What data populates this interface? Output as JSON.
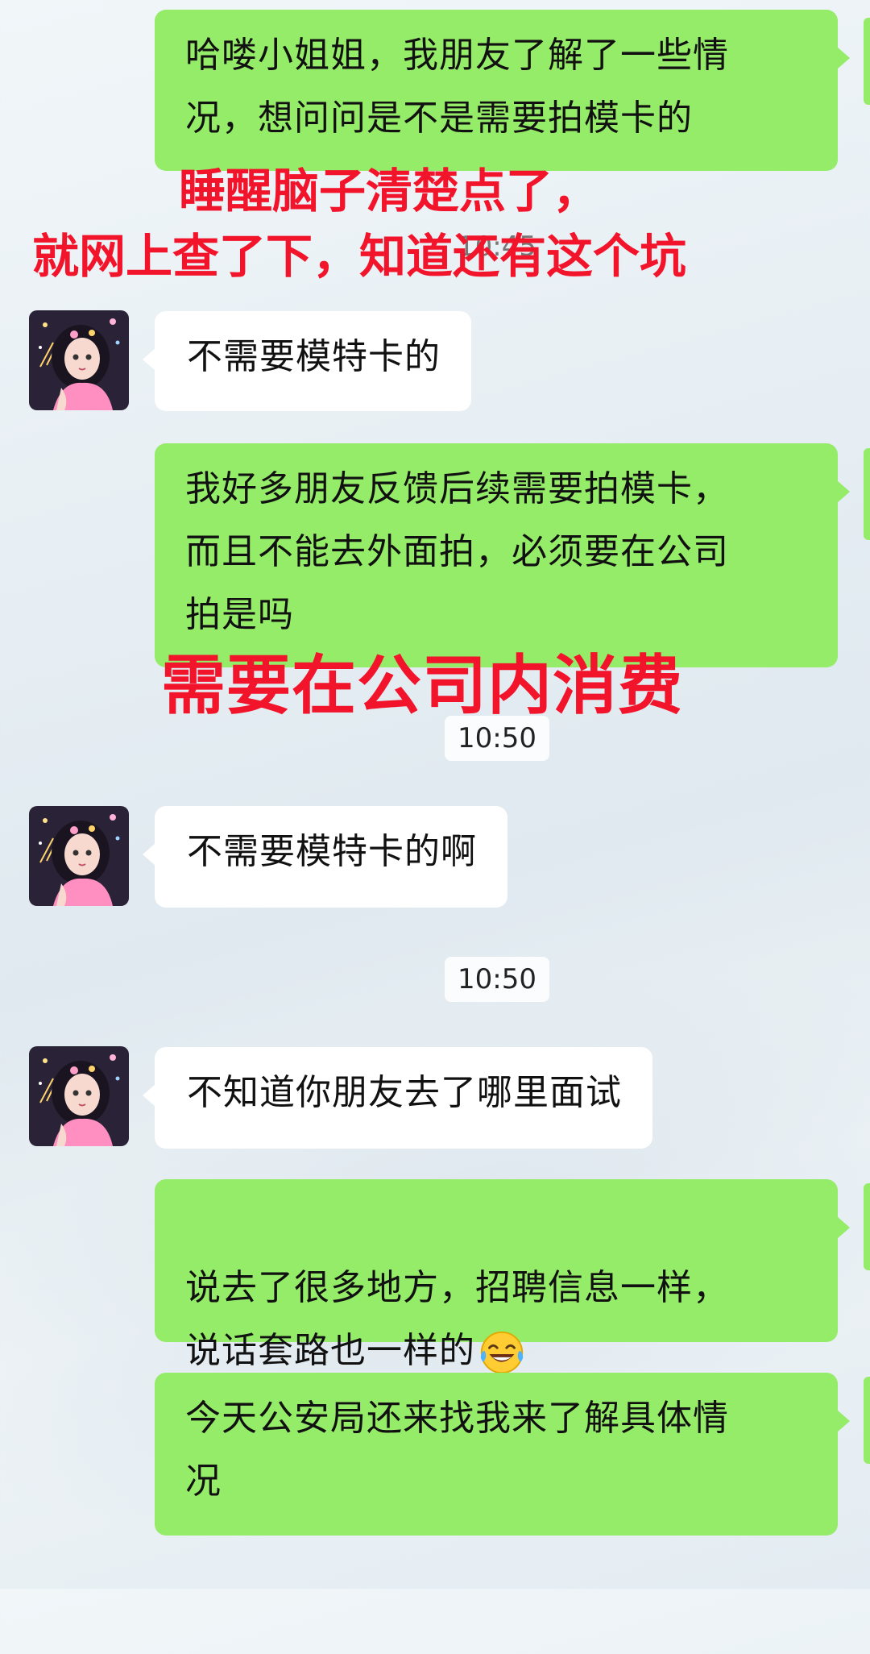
{
  "messages": [
    {
      "text": "哈喽小姐姐，我朋友了解了一些情\n况，想问问是不是需要拍模卡的"
    },
    {
      "text": "不需要模特卡的"
    },
    {
      "text": "我好多朋友反馈后续需要拍模卡，\n而且不能去外面拍，必须要在公司\n拍是吗"
    },
    {
      "text": "不需要模特卡的啊"
    },
    {
      "text": "不知道你朋友去了哪里面试"
    },
    {
      "text": "说去了很多地方，招聘信息一样，\n说话套路也一样的"
    },
    {
      "text": "今天公安局还来找我来了解具体情\n况"
    }
  ],
  "timestamps": [
    "10:45",
    "10:50",
    "10:50"
  ],
  "overlays": {
    "line1": "睡醒脑子清楚点了，",
    "line2": "就网上查了下，知道还有这个坑",
    "line3": "需要在公司内消费"
  },
  "icons": {
    "avatar": "anime-girl-avatar-icon",
    "emoji": "tears-of-joy-emoji-icon"
  },
  "colors": {
    "sent_bubble": "#95ec69",
    "received_bubble": "#ffffff",
    "overlay_text": "#f2142b"
  }
}
